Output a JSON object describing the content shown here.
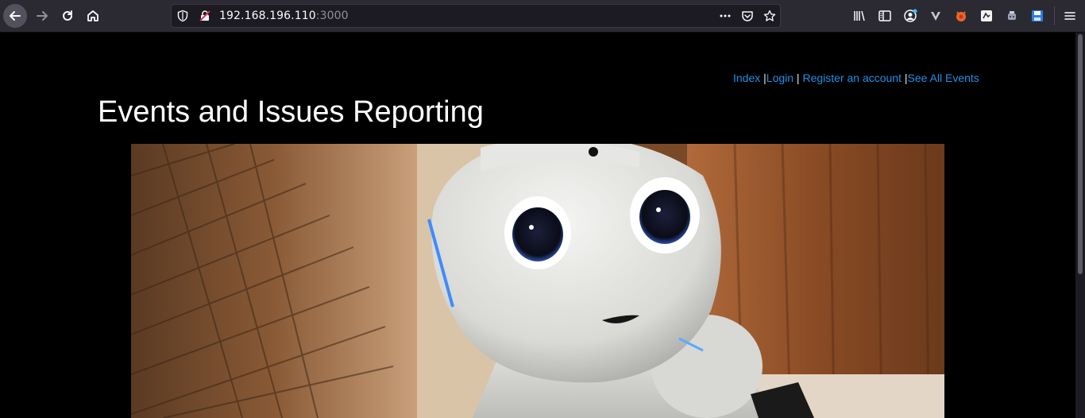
{
  "browser": {
    "url_host": "192.168.196.110",
    "url_port": ":3000"
  },
  "nav": {
    "index": "Index",
    "sep1": " |",
    "login": "Login",
    "sep2": " | ",
    "register": "Register an account",
    "sep3": " |",
    "all_events": "See All Events"
  },
  "page": {
    "title": "Events and Issues Reporting"
  },
  "icons": {
    "back": "arrow-left-icon",
    "forward": "arrow-right-icon",
    "reload": "reload-icon",
    "home": "home-icon",
    "shield": "shield-icon",
    "insecure": "insecure-lock-icon",
    "more": "more-dots-icon",
    "pocket": "pocket-icon",
    "bookmark": "star-icon",
    "library": "library-icon",
    "sidebar": "sidebar-icon",
    "account": "account-icon",
    "menu": "hamburger-menu-icon"
  },
  "colors": {
    "link": "#1e90e6",
    "background": "#000000",
    "toolbar": "#2b2a33"
  }
}
